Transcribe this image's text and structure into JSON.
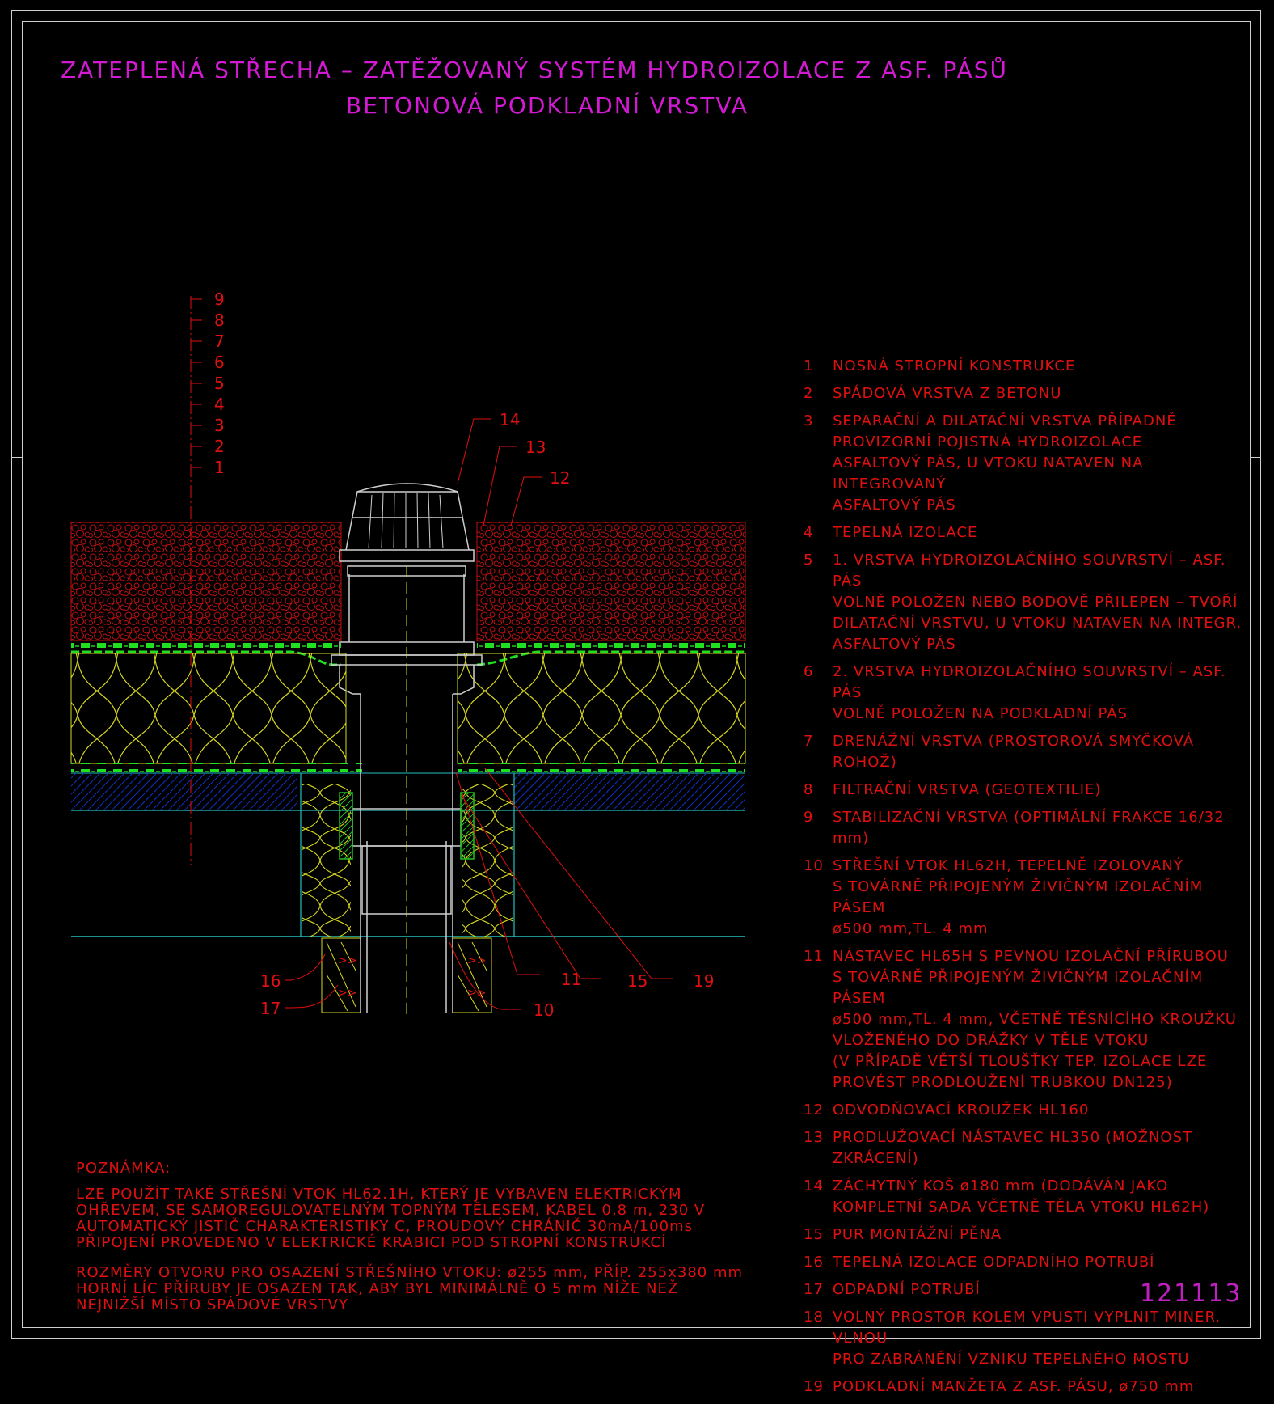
{
  "title": {
    "line1": "ZATEPLENÁ STŘECHA – ZATĚŽOVANÝ SYSTÉM HYDROIZOLACE Z ASF. PÁSŮ",
    "line2": "BETONOVÁ PODKLADNÍ VRSTVA"
  },
  "layer_labels": [
    "9",
    "8",
    "7",
    "6",
    "5",
    "4",
    "3",
    "2",
    "1"
  ],
  "callouts": {
    "c14": "14",
    "c13": "13",
    "c12": "12",
    "c16": "16",
    "c17": "17",
    "c10": "10",
    "c11": "11",
    "c15": "15",
    "c19": "19"
  },
  "legend": [
    {
      "num": "1",
      "text": "NOSNÁ STROPNÍ KONSTRUKCE"
    },
    {
      "num": "2",
      "text": "SPÁDOVÁ VRSTVA Z BETONU"
    },
    {
      "num": "3",
      "text": "SEPARAČNÍ A DILATAČNÍ VRSTVA PŘÍPADNĚ\nPROVIZORNÍ POJISTNÁ HYDROIZOLACE\nASFALTOVÝ PÁS, U VTOKU NATAVEN NA INTEGROVANÝ\nASFALTOVÝ PÁS"
    },
    {
      "num": "4",
      "text": "TEPELNÁ IZOLACE"
    },
    {
      "num": "5",
      "text": "1. VRSTVA HYDROIZOLAČNÍHO SOUVRSTVÍ – ASF. PÁS\nVOLNĚ POLOŽEN NEBO BODOVĚ PŘILEPEN – TVOŘÍ\nDILATAČNÍ VRSTVU, U VTOKU NATAVEN NA INTEGR.\nASFALTOVÝ PÁS"
    },
    {
      "num": "6",
      "text": "2. VRSTVA HYDROIZOLAČNÍHO SOUVRSTVÍ – ASF. PÁS\nVOLNĚ POLOŽEN NA PODKLADNÍ PÁS"
    },
    {
      "num": "7",
      "text": "DRENÁŽNÍ VRSTVA (PROSTOROVÁ SMYČKOVÁ ROHOŽ)"
    },
    {
      "num": "8",
      "text": "FILTRAČNÍ VRSTVA (GEOTEXTILIE)"
    },
    {
      "num": "9",
      "text": "STABILIZAČNÍ VRSTVA (OPTIMÁLNÍ FRAKCE 16/32 mm)"
    },
    {
      "num": "10",
      "text": "STŘEŠNÍ VTOK HL62H, TEPELNĚ IZOLOVANÝ\nS TOVÁRNĚ PŘIPOJENÝM ŽIVIČNÝM IZOLAČNÍM PÁSEM\nø500 mm,TL. 4 mm"
    },
    {
      "num": "11",
      "text": "NÁSTAVEC HL65H S PEVNOU IZOLAČNÍ PŘÍRUBOU\nS TOVÁRNĚ PŘIPOJENÝM ŽIVIČNÝM IZOLAČNÍM PÁSEM\nø500 mm,TL. 4 mm, VČETNĚ TĚSNÍCÍHO KROUŽKU\nVLOŽENÉHO DO DRÁŽKY V TĚLE VTOKU\n(V PŘÍPADĚ VĚTŠÍ TLOUŠŤKY TEP. IZOLACE LZE\nPROVÉST PRODLOUŽENÍ TRUBKOU DN125)"
    },
    {
      "num": "12",
      "text": "ODVODŇOVACÍ KROUŽEK HL160"
    },
    {
      "num": "13",
      "text": "PRODLUŽOVACÍ NÁSTAVEC HL350 (MOŽNOST ZKRÁCENÍ)"
    },
    {
      "num": "14",
      "text": "ZÁCHYTNÝ KOŠ ø180 mm (DODÁVÁN JAKO\nKOMPLETNÍ SADA VČETNĚ TĚLA VTOKU HL62H)"
    },
    {
      "num": "15",
      "text": "PUR MONTÁŽNÍ PĚNA"
    },
    {
      "num": "16",
      "text": "TEPELNÁ IZOLACE ODPADNÍHO POTRUBÍ"
    },
    {
      "num": "17",
      "text": "ODPADNÍ POTRUBÍ"
    },
    {
      "num": "18",
      "text": "VOLNÝ PROSTOR KOLEM VPUSTI VYPLNIT MINER. VLNOU\nPRO ZABRÁNĚNÍ VZNIKU TEPELNÉHO MOSTU"
    },
    {
      "num": "19",
      "text": "PODKLADNÍ MANŽETA Z ASF. PÁSU, ø750 mm"
    }
  ],
  "note": {
    "heading": "POZNÁMKA:",
    "para1": "LZE POUŽÍT TAKÉ STŘEŠNÍ VTOK HL62.1H, KTERÝ JE VYBAVEN ELEKTRICKÝM\nOHŘEVEM, SE SAMOREGULOVATELNÝM TOPNÝM TĚLESEM, KABEL 0,8 m, 230 V\nAUTOMATICKÝ JISTIČ CHARAKTERISTIKY C, PROUDOVÝ CHRÁNIČ 30mA/100ms\nPŘIPOJENÍ PROVEDENO V ELEKTRICKÉ KRABICI POD STROPNÍ KONSTRUKCÍ",
    "para2": "ROZMĚRY OTVORU PRO OSAZENÍ STŘEŠNÍHO VTOKU: ø255 mm, PŘÍP. 255x380 mm\nHORNÍ LÍC PŘÍRUBY JE OSAZEN TAK, ABY BYL MINIMÁLNĚ O 5 mm NÍŽE NEŽ\nNEJNIŽŠÍ MÍSTO SPÁDOVÉ VRSTVY"
  },
  "drawing_code": "121113",
  "colors": {
    "title": "#d21ad2",
    "text": "#e01010",
    "gravel": "#c01010",
    "insulation": "#d8d820",
    "drainage": "#20e020",
    "concrete": "#1030c0",
    "slab_line": "#20c0c0",
    "outline": "#cfcfcf"
  }
}
